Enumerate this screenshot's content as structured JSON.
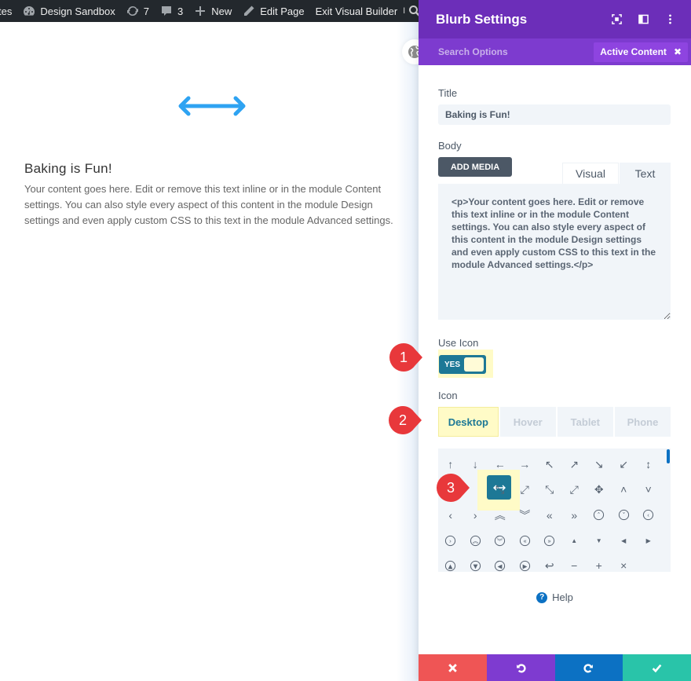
{
  "adminbar": {
    "items": [
      {
        "icon": "truncated",
        "label": "tes"
      },
      {
        "icon": "dashboard-icon",
        "label": "Design Sandbox"
      },
      {
        "icon": "updates-icon",
        "label": "7"
      },
      {
        "icon": "comment-icon",
        "label": "3"
      },
      {
        "icon": "plus-icon",
        "label": "New"
      },
      {
        "icon": "pencil-icon",
        "label": "Edit Page"
      },
      {
        "icon": "",
        "label": "Exit Visual Builder"
      }
    ],
    "right_text": "I",
    "search_icon": "search-icon"
  },
  "page": {
    "blurb_icon": "left-right-arrow-icon",
    "blurb_title": "Baking is Fun!",
    "blurb_body": "Your content goes here. Edit or remove this text inline or in the module Content settings. You can also style every aspect of this content in the module Design settings and even apply custom CSS to this text in the module Advanced settings.",
    "floating_icon": "globe-icon",
    "accent_color": "#2ea3f2"
  },
  "panel": {
    "title": "Blurb Settings",
    "header_icons": [
      "fullscreen-icon",
      "split-view-icon",
      "more-options-icon"
    ],
    "search_placeholder": "Search Options",
    "active_filter": "Active Content",
    "active_filter_close": "✖",
    "colors": {
      "header": "#6c2eb9",
      "subheader": "#7d3bcf",
      "toggle": "#1d7896",
      "highlight": "#fffbc7"
    },
    "fields": {
      "title_label": "Title",
      "title_value": "Baking is Fun!",
      "body_label": "Body",
      "add_media": "ADD MEDIA",
      "tab_visual": "Visual",
      "tab_text": "Text",
      "body_value": "<p>Your content goes here. Edit or remove this text inline or in the module Content settings. You can also style every aspect of this content in the module Design settings and even apply custom CSS to this text in the module Advanced settings.</p>",
      "use_icon_label": "Use Icon",
      "use_icon_value": "YES",
      "icon_label": "Icon"
    },
    "responsive_tabs": [
      {
        "label": "Desktop",
        "active": true
      },
      {
        "label": "Hover",
        "active": false
      },
      {
        "label": "Tablet",
        "active": false
      },
      {
        "label": "Phone",
        "active": false
      }
    ],
    "icon_grid": [
      "↑",
      "↓",
      "←",
      "→",
      "↖",
      "↗",
      "↘",
      "↙",
      "↕",
      "",
      "↔",
      "⤡",
      "⤢",
      "⤡",
      "⤢",
      "✥",
      "˄",
      "˅",
      "‹",
      "›",
      "⌃⌃",
      "⌄⌄",
      "«",
      "»",
      "⌃○",
      "⌄○",
      "‹○",
      "›○",
      "⌃⌃○",
      "⌄⌄○",
      "«○",
      "»○",
      "▲",
      "▼",
      "◀",
      "▶",
      "▲○",
      "▼○",
      "◀○",
      "▶○",
      "↩",
      "−",
      "+",
      "×"
    ],
    "selected_icon": "↔",
    "help_label": "Help",
    "footer_buttons": [
      {
        "name": "discard",
        "icon": "close-icon",
        "color": "#ef5555"
      },
      {
        "name": "undo",
        "icon": "undo-icon",
        "color": "#7e3bd0"
      },
      {
        "name": "redo",
        "icon": "redo-icon",
        "color": "#0c71c3"
      },
      {
        "name": "save",
        "icon": "check-icon",
        "color": "#29c4a9"
      }
    ]
  },
  "annotations": [
    {
      "number": "1",
      "target": "use-icon-toggle"
    },
    {
      "number": "2",
      "target": "desktop-tab"
    },
    {
      "number": "3",
      "target": "selected-icon"
    }
  ]
}
